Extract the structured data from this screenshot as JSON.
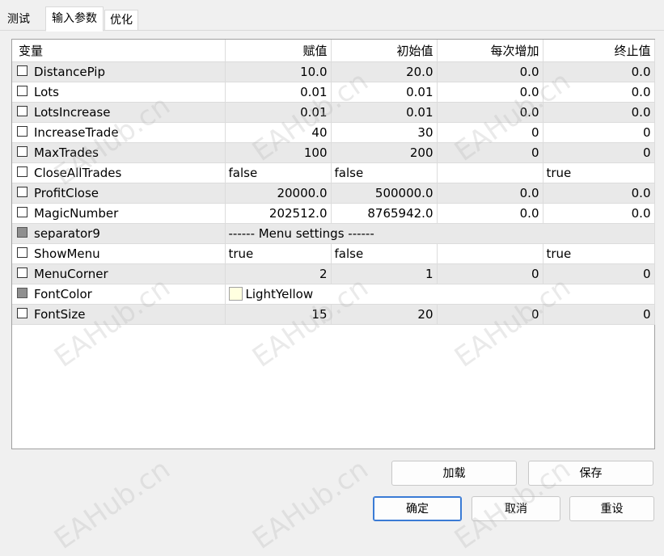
{
  "tabs": [
    {
      "label": "测试"
    },
    {
      "label": "输入参数"
    },
    {
      "label": "优化"
    }
  ],
  "columns": {
    "name": "变量",
    "value": "赋值",
    "start": "初始值",
    "step": "每次增加",
    "stop": "终止值"
  },
  "rows": [
    {
      "name": "DistancePip",
      "value": "10.0",
      "start": "20.0",
      "step": "0.0",
      "stop": "0.0"
    },
    {
      "name": "Lots",
      "value": "0.01",
      "start": "0.01",
      "step": "0.0",
      "stop": "0.0"
    },
    {
      "name": "LotsIncrease",
      "value": "0.01",
      "start": "0.01",
      "step": "0.0",
      "stop": "0.0"
    },
    {
      "name": "IncreaseTrade",
      "value": "40",
      "start": "30",
      "step": "0",
      "stop": "0"
    },
    {
      "name": "MaxTrades",
      "value": "100",
      "start": "200",
      "step": "0",
      "stop": "0"
    },
    {
      "name": "CloseAllTrades",
      "value": "false",
      "start": "false",
      "step": "",
      "stop": "true"
    },
    {
      "name": "ProfitClose",
      "value": "20000.0",
      "start": "500000.0",
      "step": "0.0",
      "stop": "0.0"
    },
    {
      "name": "MagicNumber",
      "value": "202512.0",
      "start": "8765942.0",
      "step": "0.0",
      "stop": "0.0"
    },
    {
      "name": "separator9",
      "value": "------ Menu settings ------"
    },
    {
      "name": "ShowMenu",
      "value": "true",
      "start": "false",
      "step": "",
      "stop": "true"
    },
    {
      "name": "MenuCorner",
      "value": "2",
      "start": "1",
      "step": "0",
      "stop": "0"
    },
    {
      "name": "FontColor",
      "value": "LightYellow",
      "color": "#FFFFE0"
    },
    {
      "name": "FontSize",
      "value": "15",
      "start": "20",
      "step": "0",
      "stop": "0"
    }
  ],
  "buttons": {
    "load": "加载",
    "save": "保存",
    "ok": "确定",
    "cancel": "取消",
    "reset": "重设"
  },
  "watermark": "EAHub.cn"
}
